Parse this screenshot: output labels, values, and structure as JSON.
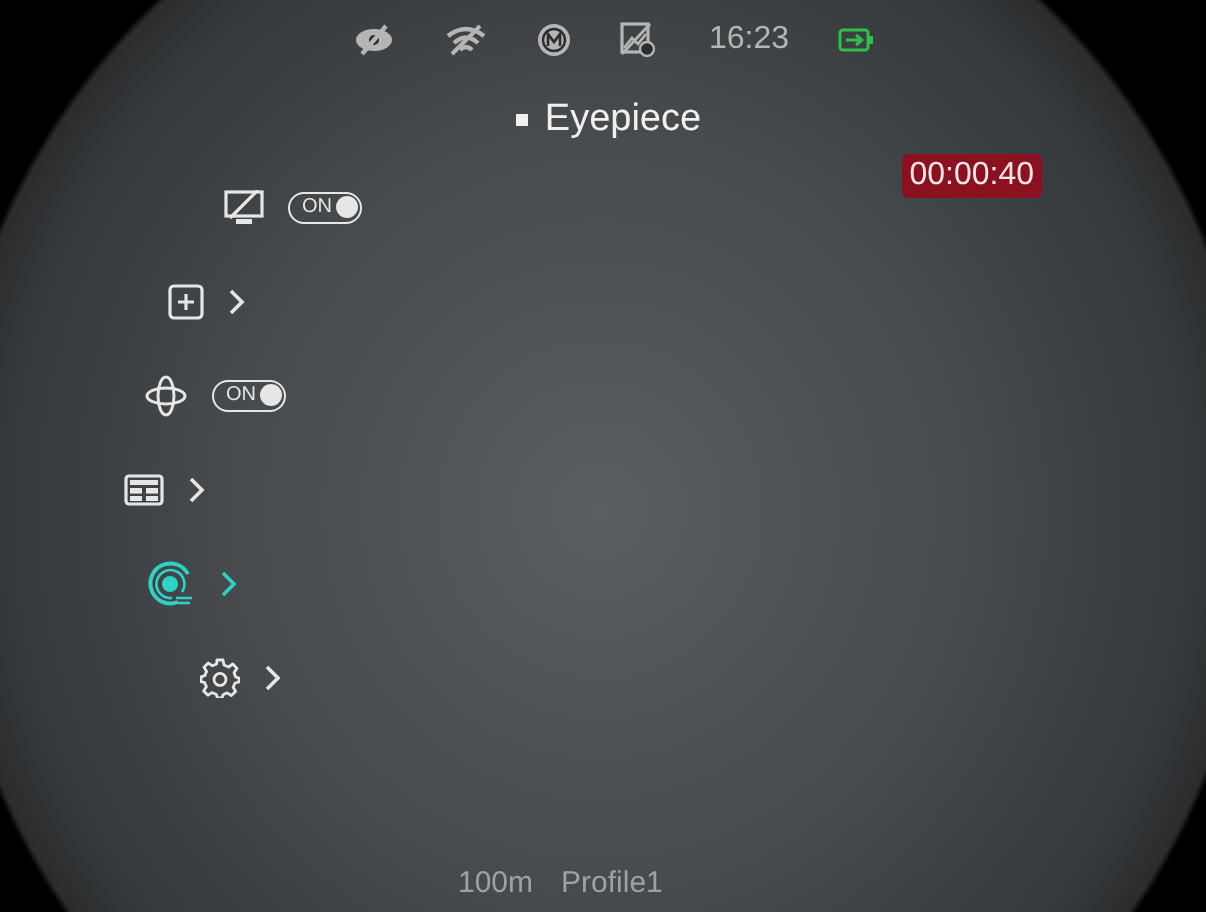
{
  "status_bar": {
    "time": "16:23"
  },
  "title": "Eyepiece",
  "recording": {
    "time": "00:00:40"
  },
  "menu": [
    {
      "kind": "toggle",
      "label": "ON",
      "on": true,
      "selected": false
    },
    {
      "kind": "submenu",
      "selected": false
    },
    {
      "kind": "toggle",
      "label": "ON",
      "on": true,
      "selected": false
    },
    {
      "kind": "submenu",
      "selected": false
    },
    {
      "kind": "submenu",
      "selected": true
    },
    {
      "kind": "submenu",
      "selected": false
    }
  ],
  "footer": {
    "distance": "100m",
    "profile": "Profile1"
  }
}
